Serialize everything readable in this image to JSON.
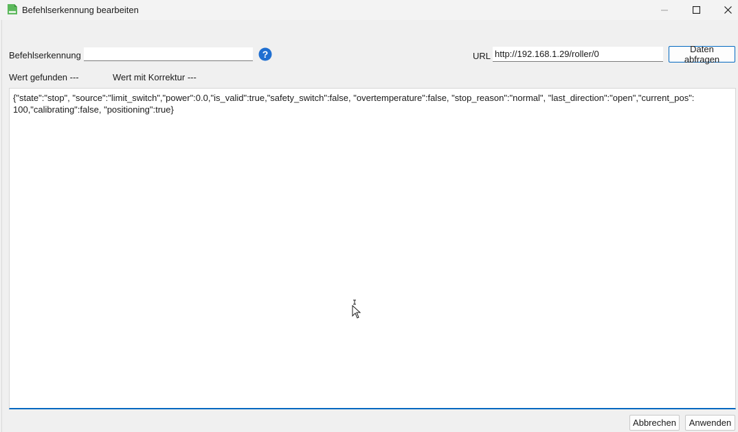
{
  "window": {
    "title": "Befehlserkennung bearbeiten",
    "controls": {
      "minimize": "—",
      "maximize": "☐",
      "close": "✕"
    }
  },
  "form": {
    "befehl_label": "Befehlserkennung",
    "befehl_value": "",
    "url_label": "URL",
    "url_value": "http://192.168.1.29/roller/0",
    "query_button": "Daten abfragen",
    "wert_gefunden": "Wert gefunden ---",
    "wert_korrektur": "Wert mit Korrektur ---",
    "response_text": "{\"state\":\"stop\", \"source\":\"limit_switch\",\"power\":0.0,\"is_valid\":true,\"safety_switch\":false, \"overtemperature\":false, \"stop_reason\":\"normal\", \"last_direction\":\"open\",\"current_pos\":\n100,\"calibrating\":false, \"positioning\":true}"
  },
  "footer": {
    "cancel_button": "Abbrechen",
    "apply_button": "Anwenden"
  },
  "colors": {
    "accent": "#0067c0",
    "help_icon": "#1f6fd1",
    "app_icon": "#5cb85c"
  }
}
